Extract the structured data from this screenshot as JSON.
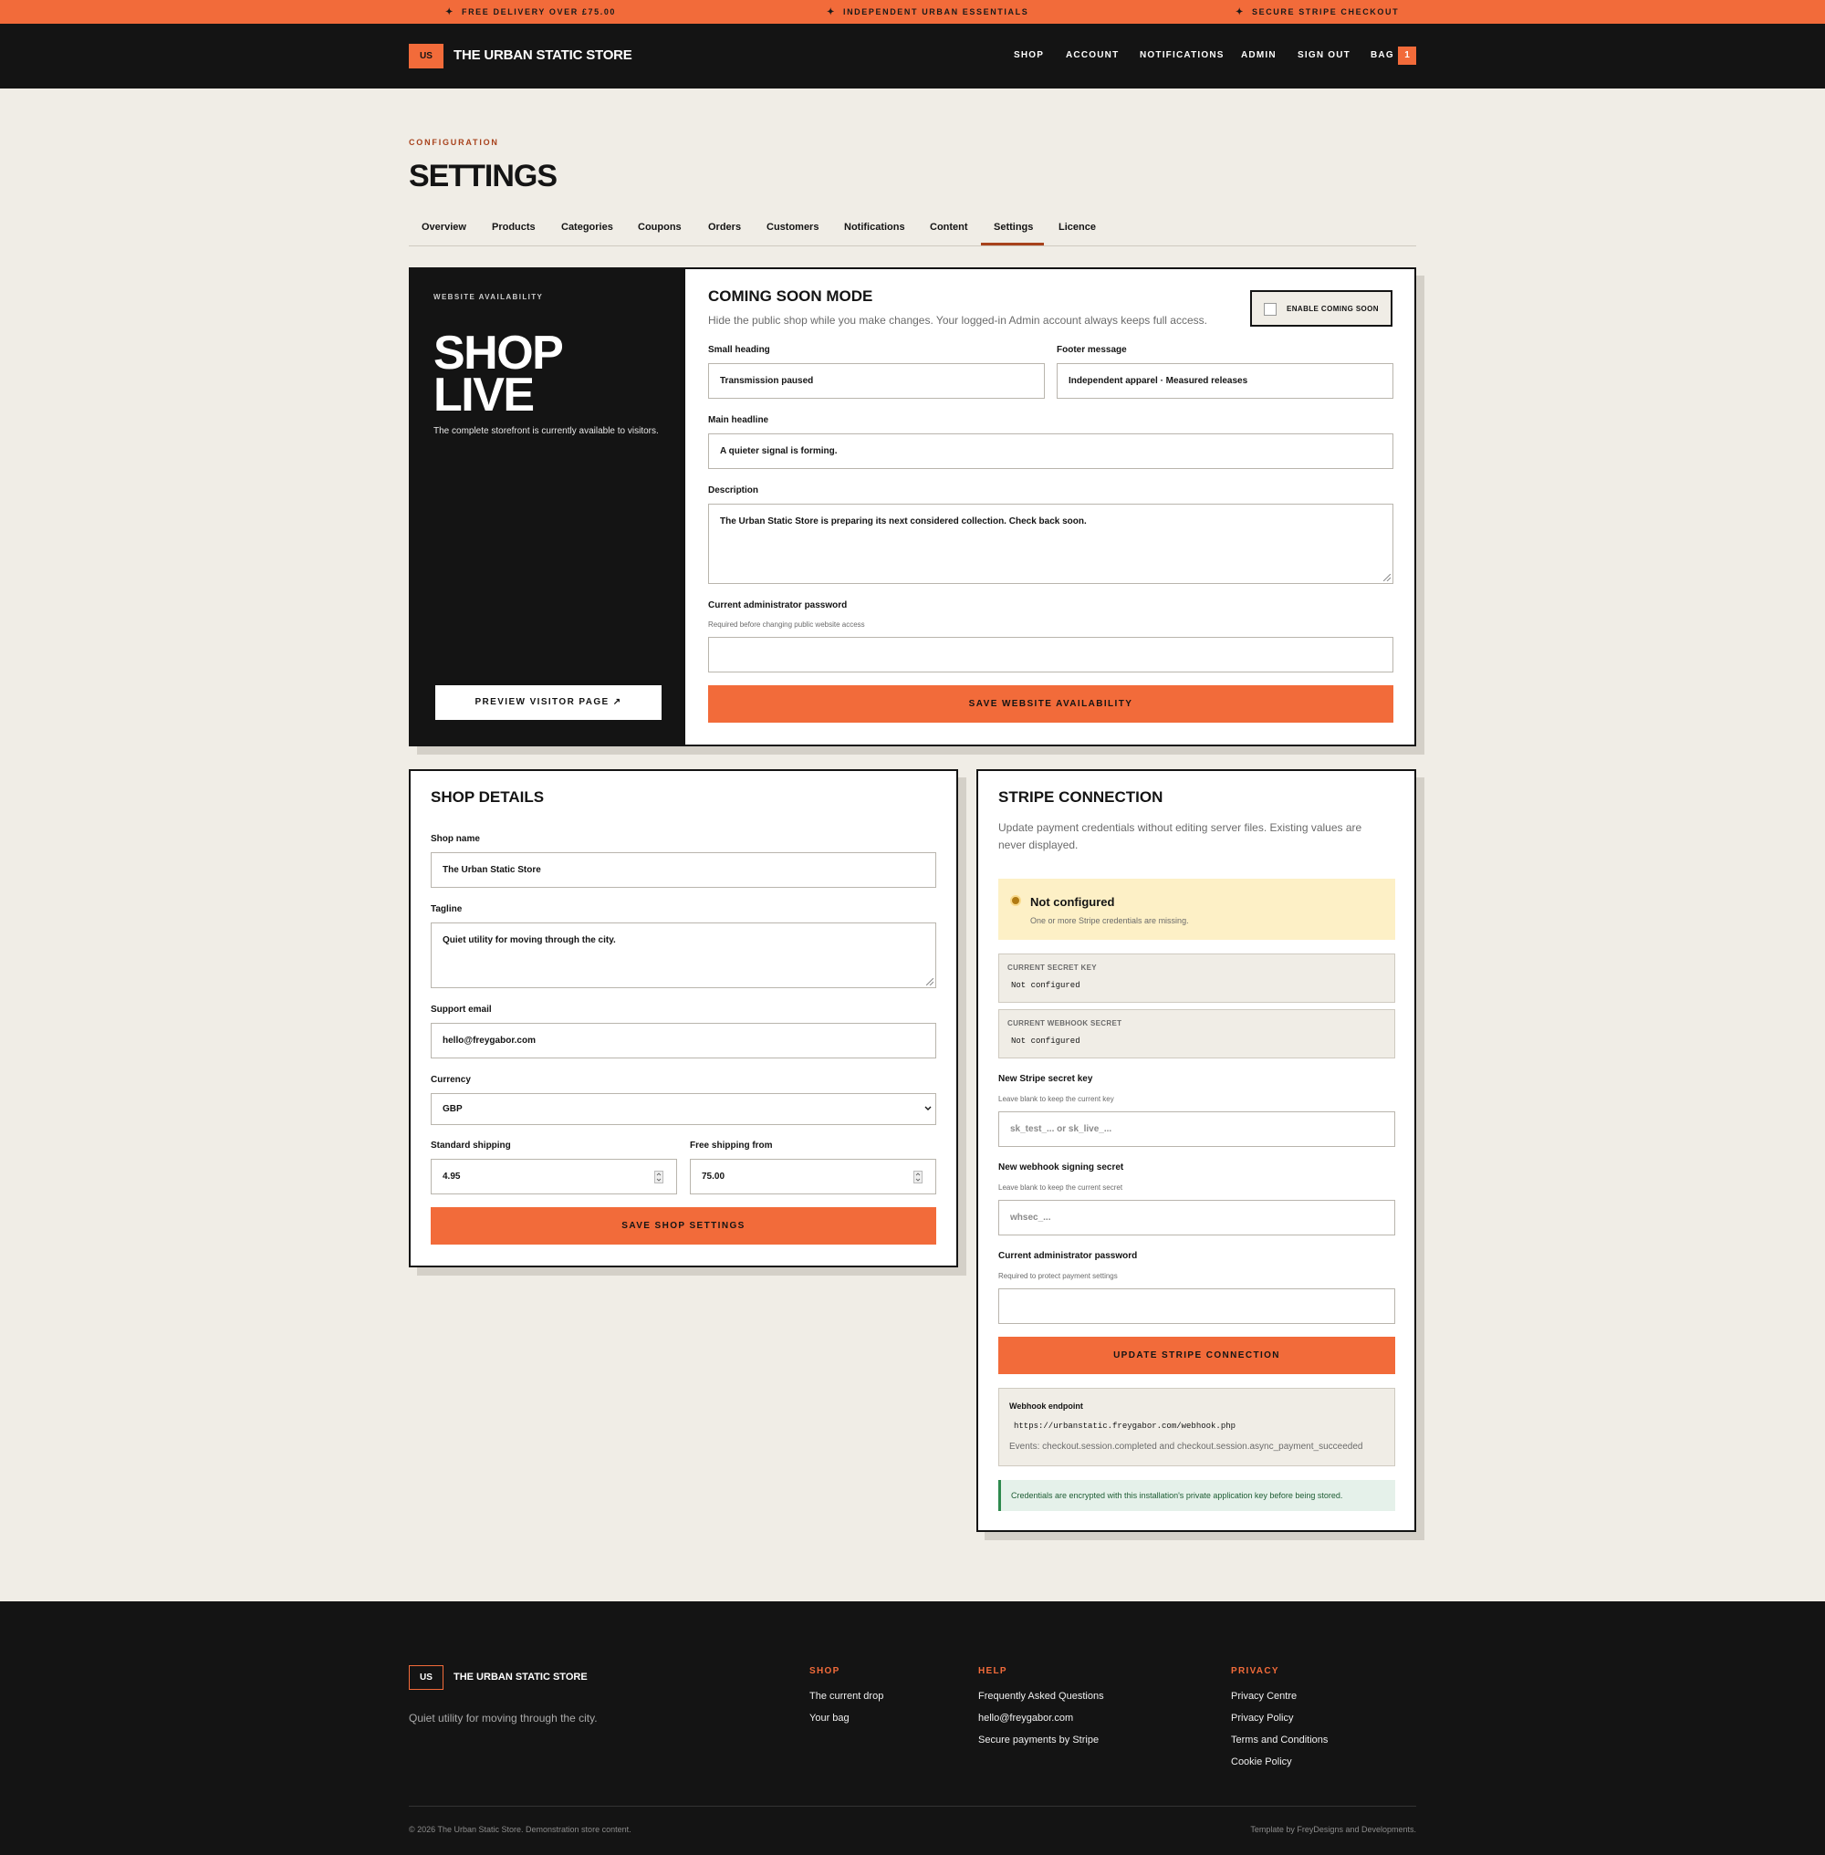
{
  "promo": {
    "items": [
      "FREE DELIVERY OVER £75.00",
      "INDEPENDENT URBAN ESSENTIALS",
      "SECURE STRIPE CHECKOUT"
    ],
    "star": "✦"
  },
  "header": {
    "logo_mark": "US",
    "store_name": "THE URBAN STATIC STORE",
    "nav": [
      "SHOP",
      "ACCOUNT",
      "NOTIFICATIONS",
      "ADMIN",
      "SIGN OUT",
      "BAG"
    ],
    "bag_count": "1"
  },
  "page": {
    "eyebrow": "CONFIGURATION",
    "title": "SETTINGS",
    "tabs": [
      "Overview",
      "Products",
      "Categories",
      "Coupons",
      "Orders",
      "Customers",
      "Notifications",
      "Content",
      "Settings",
      "Licence"
    ],
    "active_tab": "Settings"
  },
  "availability": {
    "eyebrow": "WEBSITE AVAILABILITY",
    "status_line1": "SHOP",
    "status_line2": "LIVE",
    "status_text": "The complete storefront is currently available to visitors.",
    "preview_button": "PREVIEW VISITOR PAGE ↗",
    "title": "COMING SOON MODE",
    "description": "Hide the public shop while you make changes. Your logged-in Admin account always keeps full access.",
    "toggle_label": "ENABLE COMING SOON",
    "toggle_checked": false,
    "small_heading_label": "Small heading",
    "small_heading_value": "Transmission paused",
    "footer_message_label": "Footer message",
    "footer_message_value": "Independent apparel · Measured releases",
    "main_headline_label": "Main headline",
    "main_headline_value": "A quieter signal is forming.",
    "description_label": "Description",
    "description_value": "The Urban Static Store is preparing its next considered collection. Check back soon.",
    "password_label": "Current administrator password",
    "password_hint": "Required before changing public website access",
    "save_button": "SAVE WEBSITE AVAILABILITY"
  },
  "shop_details": {
    "title": "SHOP DETAILS",
    "shop_name_label": "Shop name",
    "shop_name_value": "The Urban Static Store",
    "tagline_label": "Tagline",
    "tagline_value": "Quiet utility for moving through the city.",
    "support_email_label": "Support email",
    "support_email_value": "hello@freygabor.com",
    "currency_label": "Currency",
    "currency_value": "GBP",
    "standard_shipping_label": "Standard shipping",
    "standard_shipping_value": "4.95",
    "free_shipping_label": "Free shipping from",
    "free_shipping_value": "75.00",
    "save_button": "SAVE SHOP SETTINGS"
  },
  "stripe": {
    "title": "STRIPE CONNECTION",
    "description": "Update payment credentials without editing server files. Existing values are never displayed.",
    "status_title": "Not configured",
    "status_sub": "One or more Stripe credentials are missing.",
    "secret_key_label": "CURRENT SECRET KEY",
    "secret_key_value": "Not configured",
    "webhook_secret_label": "CURRENT WEBHOOK SECRET",
    "webhook_secret_value": "Not configured",
    "new_secret_label": "New Stripe secret key",
    "new_secret_hint": "Leave blank to keep the current key",
    "new_secret_placeholder": "sk_test_... or sk_live_...",
    "new_webhook_label": "New webhook signing secret",
    "new_webhook_hint": "Leave blank to keep the current secret",
    "new_webhook_placeholder": "whsec_...",
    "password_label": "Current administrator password",
    "password_hint": "Required to protect payment settings",
    "update_button": "UPDATE STRIPE CONNECTION",
    "endpoint_label": "Webhook endpoint",
    "endpoint_url": "https://urbanstatic.freygabor.com/webhook.php",
    "endpoint_events": "Events: checkout.session.completed and checkout.session.async_payment_succeeded",
    "encryption_note": "Credentials are encrypted with this installation's private application key before being stored."
  },
  "footer": {
    "logo_mark": "US",
    "store_name": "THE URBAN STATIC STORE",
    "tagline": "Quiet utility for moving through the city.",
    "shop_heading": "SHOP",
    "shop_links": [
      "The current drop",
      "Your bag"
    ],
    "help_heading": "HELP",
    "help_links": [
      "Frequently Asked Questions",
      "hello@freygabor.com",
      "Secure payments by Stripe"
    ],
    "privacy_heading": "PRIVACY",
    "privacy_links": [
      "Privacy Centre",
      "Privacy Policy",
      "Terms and Conditions",
      "Cookie Policy"
    ],
    "copyright": "© 2026 The Urban Static Store. Demonstration store content.",
    "credit": "Template by FreyDesigns and Developments."
  },
  "colors": {
    "accent": "#f26b3a",
    "dark": "#141414",
    "background": "#f0ede6",
    "warning_bg": "#fdf0c6",
    "success_bg": "#e5f1ea"
  }
}
